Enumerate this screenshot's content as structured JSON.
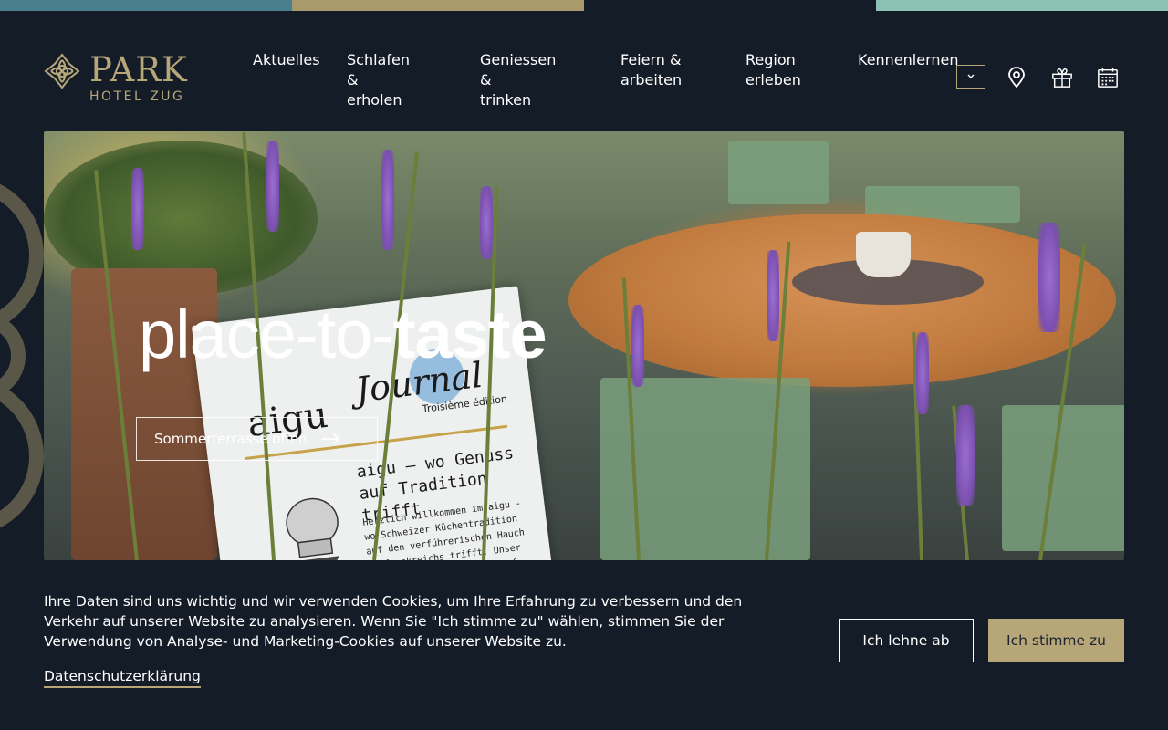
{
  "brand": {
    "title": "PARK",
    "subtitle": "HOTEL ZUG",
    "gold": "#b6a678",
    "dark": "#141c28"
  },
  "topbar": {
    "colors": [
      "#4a7f8f",
      "#a89a6a",
      "#141c28",
      "#8cc2b4"
    ]
  },
  "nav": {
    "items": [
      {
        "label": "Aktuelles"
      },
      {
        "label": "Schlafen &\nerholen"
      },
      {
        "label": "Geniessen &\ntrinken"
      },
      {
        "label": "Feiern &\narbeiten"
      },
      {
        "label": "Region\nerleben"
      },
      {
        "label": "Kennenlernen"
      }
    ],
    "dropdown_icon": "chevron-down-icon",
    "icons": [
      "location-pin-icon",
      "gift-icon",
      "calendar-icon"
    ]
  },
  "hero": {
    "title_light": "place-to-",
    "title_bold": "taste",
    "button_label": "Sommerterrasse offen",
    "button_icon": "arrow-right-icon",
    "menu_card": {
      "brand": "aigu",
      "journal": "Journal",
      "edition": "Troisième édition",
      "headline": "aigu – wo Genuss\nauf Tradition trifft",
      "body": "Herzlich willkommen im aigu - wo Schweizer Küchentradition auf den verführerischen Hauch Südfrankreichs trifft. Unser Küchenteam entführt Sie auf eine kulinarische Reise von"
    }
  },
  "cookie": {
    "text": "Ihre Daten sind uns wichtig und wir verwenden Cookies, um Ihre Erfahrung zu verbessern und den Verkehr auf unserer Website zu analysieren. Wenn Sie \"Ich stimme zu\" wählen, stimmen Sie der Verwendung von Analyse- und Marketing-Cookies auf unserer Website zu.",
    "privacy_link": "Datenschutzerklärung",
    "decline_label": "Ich lehne ab",
    "accept_label": "Ich stimme zu"
  }
}
